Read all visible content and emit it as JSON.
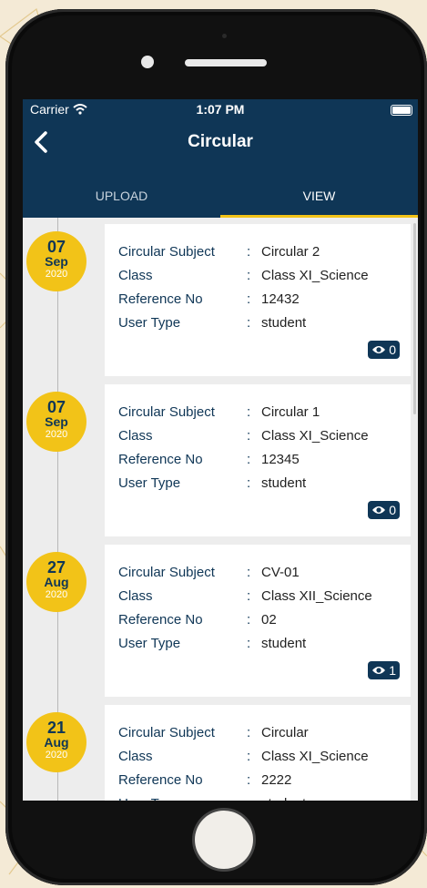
{
  "status": {
    "carrier": "Carrier",
    "time": "1:07 PM"
  },
  "header": {
    "title": "Circular"
  },
  "tabs": [
    {
      "label": "UPLOAD"
    },
    {
      "label": "VIEW"
    }
  ],
  "labels": {
    "subject": "Circular Subject",
    "class": "Class",
    "reference": "Reference No",
    "user_type": "User Type",
    "sep": ":"
  },
  "circulars": [
    {
      "day": "07",
      "month": "Sep",
      "year": "2020",
      "subject": "Circular 2",
      "class": "Class XI_Science",
      "reference": "12432",
      "user_type": "student",
      "views": "0"
    },
    {
      "day": "07",
      "month": "Sep",
      "year": "2020",
      "subject": "Circular 1",
      "class": "Class XI_Science",
      "reference": "12345",
      "user_type": "student",
      "views": "0"
    },
    {
      "day": "27",
      "month": "Aug",
      "year": "2020",
      "subject": "CV-01",
      "class": "Class XII_Science",
      "reference": "02",
      "user_type": "student",
      "views": "1"
    },
    {
      "day": "21",
      "month": "Aug",
      "year": "2020",
      "subject": "Circular",
      "class": "Class XI_Science",
      "reference": "2222",
      "user_type": "student",
      "views": ""
    }
  ],
  "colors": {
    "primary": "#0f3656",
    "accent": "#f2c318",
    "background": "#ededed"
  }
}
